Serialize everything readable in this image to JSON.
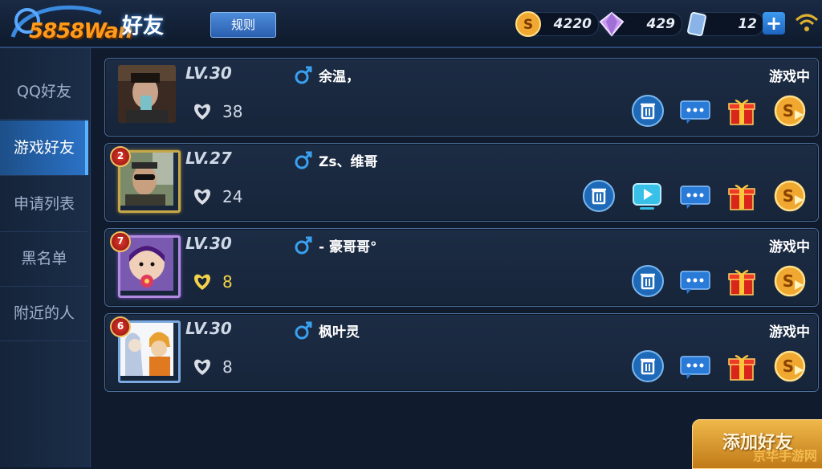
{
  "header": {
    "logo_text": "5858Wan",
    "title": "好友",
    "rules_label": "规则",
    "coins": "4220",
    "diamonds": "429",
    "cards": "12",
    "plus_label": "+"
  },
  "sidebar": {
    "items": [
      {
        "label": "QQ好友"
      },
      {
        "label": "游戏好友"
      },
      {
        "label": "申请列表"
      },
      {
        "label": "黑名单"
      },
      {
        "label": "附近的人"
      }
    ]
  },
  "friends": [
    {
      "level": "LV.30",
      "likes": "38",
      "name": "余温，",
      "status": "游戏中",
      "rank": "",
      "heart_color": "#d8dde6",
      "frame": "none"
    },
    {
      "level": "LV.27",
      "likes": "24",
      "name": "Zs、维哥",
      "status": "",
      "rank": "2",
      "heart_color": "#d8dde6",
      "frame": "gold"
    },
    {
      "level": "LV.30",
      "likes": "8",
      "name": "- 豪哥哥°",
      "status": "游戏中",
      "rank": "7",
      "heart_color": "#f2d24a",
      "frame": "purple"
    },
    {
      "level": "LV.30",
      "likes": "8",
      "name": "枫叶灵",
      "status": "游戏中",
      "rank": "6",
      "heart_color": "#d8dde6",
      "frame": "blue"
    }
  ],
  "add_friend_label": "添加好友",
  "watermark": "京华手游网"
}
